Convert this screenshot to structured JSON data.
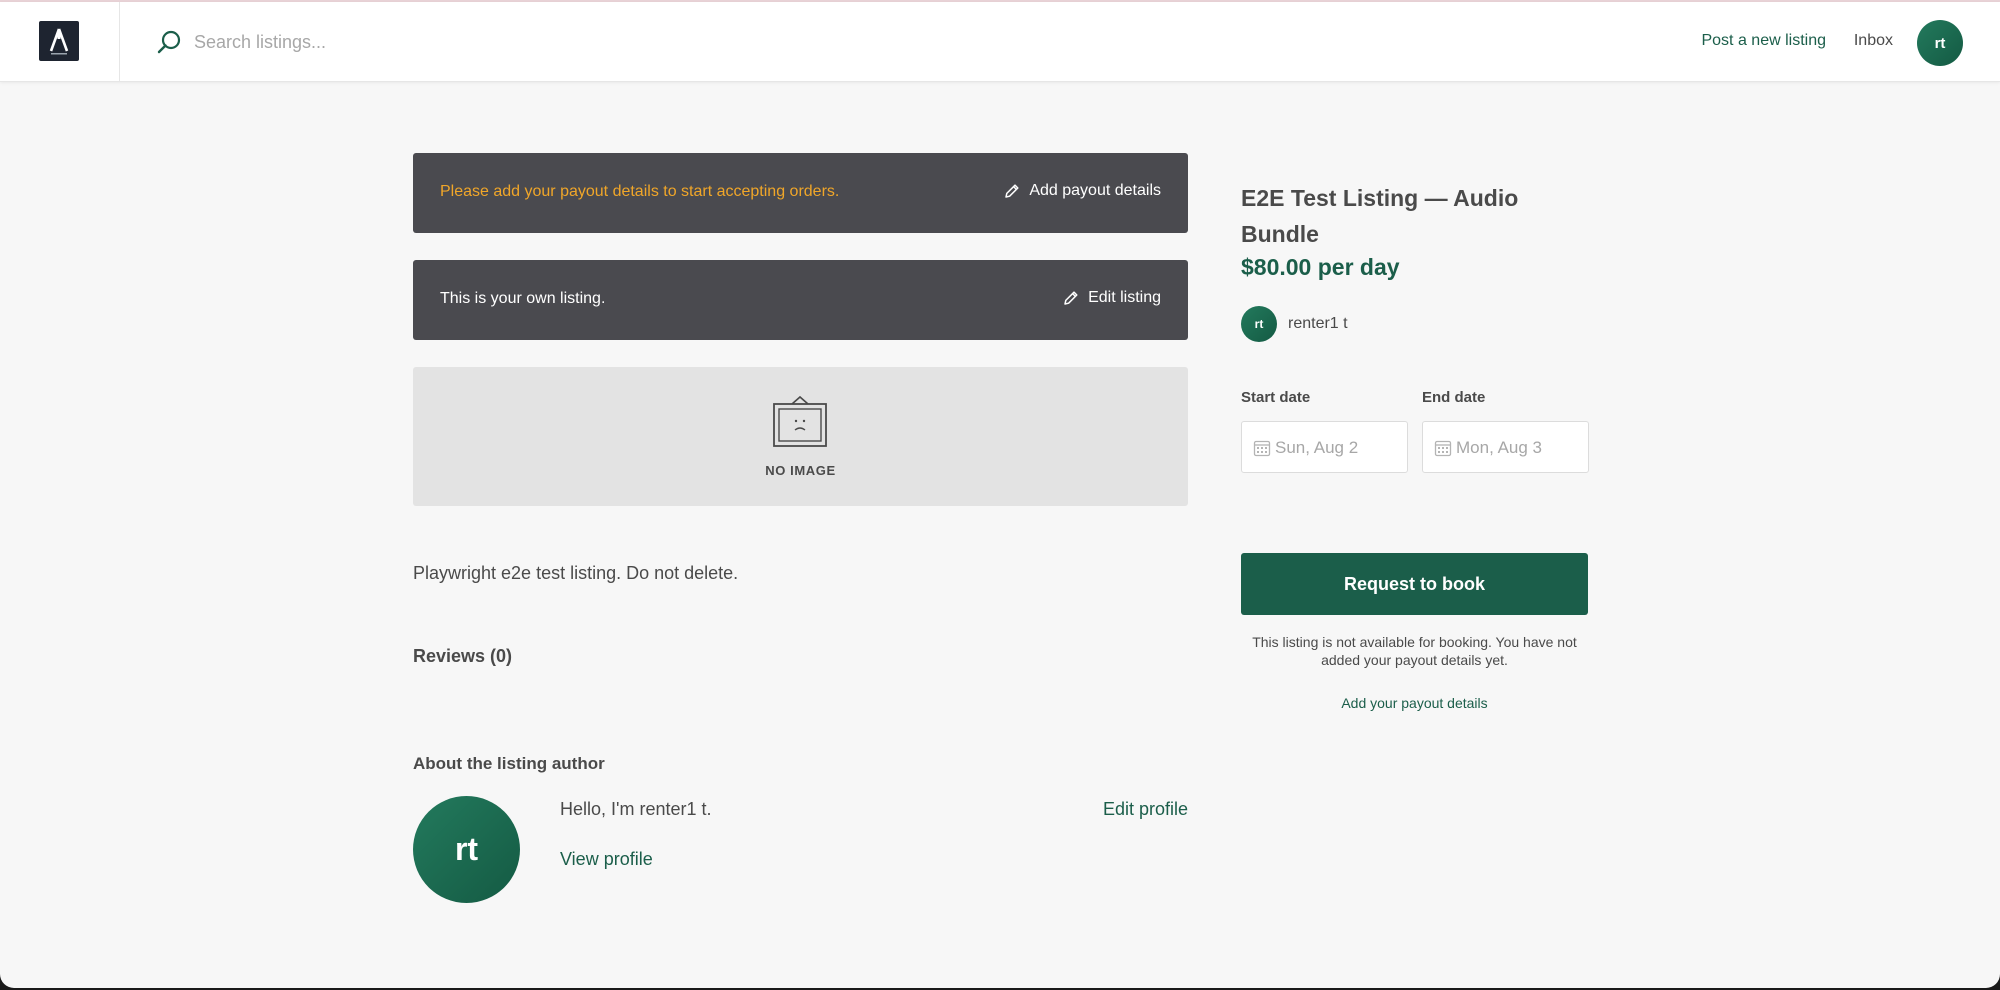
{
  "topbar": {
    "search_placeholder": "Search listings...",
    "post_listing_label": "Post a new listing",
    "inbox_label": "Inbox",
    "user_initials": "rt"
  },
  "banners": {
    "payout_message": "Please add your payout details to start accepting orders.",
    "payout_action": "Add payout details",
    "own_listing_message": "This is your own listing.",
    "own_listing_action": "Edit listing"
  },
  "listing": {
    "no_image_label": "NO IMAGE",
    "description": "Playwright e2e test listing. Do not delete.",
    "reviews_heading": "Reviews (0)",
    "title": "E2E Test Listing — Audio Bundle",
    "price": "$80.00 per day"
  },
  "author": {
    "heading": "About the listing author",
    "initials": "rt",
    "hello": "Hello, I'm renter1 t.",
    "view_profile": "View profile",
    "edit_profile": "Edit profile"
  },
  "booking": {
    "seller_initials": "rt",
    "seller_name": "renter1 t",
    "start_label": "Start date",
    "start_placeholder": "Sun, Aug 2",
    "end_label": "End date",
    "end_placeholder": "Mon, Aug 3",
    "request_button": "Request to book",
    "unavailable_text": "This listing is not available for booking. You have not added your payout details yet.",
    "add_payout_link": "Add your payout details"
  },
  "colors": {
    "brand_green": "#1b5e4a",
    "banner_bg": "#4a4a4f",
    "warning_text": "#f0a629",
    "page_bg": "#f7f7f7"
  },
  "icons": [
    "search-icon",
    "pencil-icon",
    "no-image-frame-icon",
    "calendar-icon"
  ]
}
